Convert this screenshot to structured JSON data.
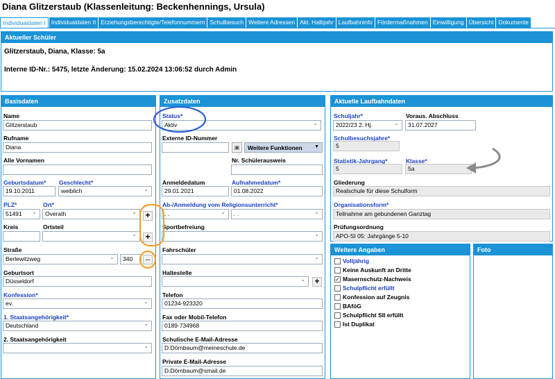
{
  "window": {
    "title": "Diana Glitzerstaub (Klassenleitung: Beckenhennings, Ursula)"
  },
  "tabs": [
    "Individualdaten I",
    "Individualdaten II",
    "Erziehungsberechtigte/Telefonnummern",
    "Schulbesuch",
    "Weitere Adressen",
    "Akt. Halbjahr",
    "Laufbahninfo",
    "Fördermaßnahmen",
    "Einwilligung",
    "Übersicht",
    "Dokumente"
  ],
  "current": {
    "header": "Aktueller Schüler",
    "line1": "Glitzerstaub, Diana, Klasse: 5a",
    "line2": "Interne ID-Nr.: 5475, letzte Änderung: 15.02.2024 13:06:52 durch Admin"
  },
  "basis": {
    "header": "Basisdaten",
    "name_label": "Name",
    "name": "Glitzerstaub",
    "rufname_label": "Rufname",
    "rufname": "Diana",
    "vornamen_label": "Alle Vornamen",
    "vornamen": "",
    "geburtsdatum_label": "Geburtsdatum*",
    "geburtsdatum": "19.10.2011",
    "geschlecht_label": "Geschlecht*",
    "geschlecht": "weiblich",
    "plz_label": "PLZ*",
    "plz": "51491",
    "ort_label": "Ort*",
    "ort": "Overath",
    "kreis_label": "Kreis",
    "kreis": "",
    "ortsteil_label": "Ortsteil",
    "ortsteil": "",
    "strasse_label": "Straße",
    "strasse": "Berlewitzweg",
    "hausnr": "340",
    "more": "...",
    "geburtsort_label": "Geburtsort",
    "geburtsort": "Düsseldorf",
    "konfession_label": "Konfession*",
    "konfession": "ev.",
    "staat1_label": "1. Staatsangehörigkeit*",
    "staat1": "Deutschland",
    "staat2_label": "2. Staatsangehörigkeit",
    "staat2": "",
    "plus": "+"
  },
  "zusatz": {
    "header": "Zusatzdaten",
    "status_label": "Status*",
    "status": "Aktiv",
    "extid_label": "Externe ID-Nummer",
    "extid": "",
    "weitere": "Weitere Funktionen",
    "ausweis_label": "Nr. Schülerausweis",
    "ausweis": "",
    "anmeldedatum_label": "Anmeldedatum",
    "anmeldedatum": "29.01.2021",
    "aufnahme_label": "Aufnahmedatum*",
    "aufnahme": "01.08.2022",
    "religion_label": "Ab-/Anmeldung vom Religionsunterricht*",
    "religion_a": ". .",
    "religion_b": ". .",
    "sport_label": "Sportbefreiung",
    "sport": "",
    "fahr_label": "Fahrschüler",
    "fahr": "",
    "halte_label": "Haltestelle",
    "halte": "",
    "telefon_label": "Telefon",
    "telefon": "01234-923320",
    "fax_label": "Fax oder Mobil-Telefon",
    "fax": "0189-734968",
    "semail_label": "Schulische E-Mail-Adresse",
    "semail": "D.Dörnbaum@meineschule.de",
    "pemail_label": "Private E-Mail-Adresse",
    "pemail": "D.Dörnbaum@smail.de"
  },
  "laufbahn": {
    "header": "Aktuelle Laufbahndaten",
    "schuljahr_label": "Schuljahr*",
    "schuljahr": "2022/23 2. Hj.",
    "abschluss_label": "Voraus. Abschluss",
    "abschluss": "31.07.2027",
    "sbj_label": "Schulbesuchsjahre*",
    "sbj": "5",
    "jg_label": "Statistik-Jahrgang*",
    "jg": "5",
    "klasse_label": "Klasse*",
    "klasse": "5a",
    "gliederung_label": "Gliederung",
    "gliederung": "Realschule für diese Schulform",
    "orgform_label": "Organisationsform*",
    "orgform": "Teilnahme am gebundenen Ganztag",
    "po_label": "Prüfungsordnung",
    "po": "APO-SI 05: Jahrgänge 5-10"
  },
  "weitere": {
    "header": "Weitere Angaben",
    "items": [
      {
        "label": "Volljährig",
        "checked": false,
        "blue": true
      },
      {
        "label": "Keine Auskunft an Dritte",
        "checked": false,
        "blue": false
      },
      {
        "label": "Masernschutz-Nachweis",
        "checked": true,
        "blue": false
      },
      {
        "label": "Schulpflicht erfüllt",
        "checked": false,
        "blue": true
      },
      {
        "label": "Konfession auf Zeugnis",
        "checked": false,
        "blue": false
      },
      {
        "label": "BAföG",
        "checked": false,
        "blue": false
      },
      {
        "label": "Schulpflicht SII erfüllt",
        "checked": false,
        "blue": false
      },
      {
        "label": "Ist Duplikat",
        "checked": false,
        "blue": false
      }
    ]
  },
  "foto": {
    "header": "Foto"
  },
  "colors": {
    "accent": "#1b93d6",
    "highlight_blue": "#2a5fd6",
    "highlight_orange": "#f0a030",
    "label_blue": "#1a3fc4"
  }
}
